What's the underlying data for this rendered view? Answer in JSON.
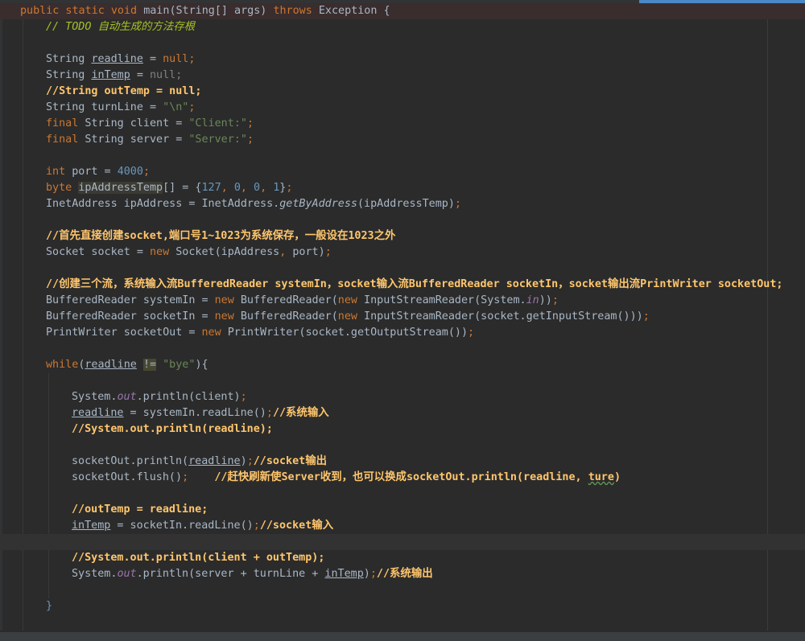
{
  "editor": {
    "language": "Java",
    "colors": {
      "background": "#2b2b2b",
      "keyword": "#cc7832",
      "number": "#6897bb",
      "string": "#6a8759",
      "comment": "#ffc66d",
      "todo": "#a8c023",
      "static_field": "#9876aa",
      "default_text": "#a9b7c6"
    },
    "lines": [
      {
        "id": "method-signature",
        "segments": [
          {
            "t": "public static void ",
            "c": "kw"
          },
          {
            "t": "main",
            "c": "pl"
          },
          {
            "t": "(String[] args) ",
            "c": "pl"
          },
          {
            "t": "throws ",
            "c": "kw"
          },
          {
            "t": "Exception {",
            "c": "pl"
          }
        ]
      },
      {
        "id": "todo-comment",
        "segments": [
          {
            "t": "// TODO 自动生成的方法存根",
            "c": "todo"
          }
        ]
      },
      {
        "id": "blank-1",
        "segments": []
      },
      {
        "id": "decl-readline",
        "segments": [
          {
            "t": "String ",
            "c": "pl"
          },
          {
            "t": "readline",
            "c": "pl u"
          },
          {
            "t": " = ",
            "c": "pl"
          },
          {
            "t": "null;",
            "c": "kw"
          }
        ]
      },
      {
        "id": "decl-intemp",
        "segments": [
          {
            "t": "String ",
            "c": "pl"
          },
          {
            "t": "inTemp",
            "c": "pl u"
          },
          {
            "t": " = ",
            "c": "pl"
          },
          {
            "t": "null;",
            "c": "nullgray"
          }
        ]
      },
      {
        "id": "comment-outtemp",
        "segments": [
          {
            "t": "//String outTemp = null;",
            "c": "cm"
          }
        ]
      },
      {
        "id": "decl-turnline",
        "segments": [
          {
            "t": "String turnLine = ",
            "c": "pl"
          },
          {
            "t": "\"\\n\"",
            "c": "str"
          },
          {
            "t": ";",
            "c": "punc"
          }
        ]
      },
      {
        "id": "decl-client",
        "segments": [
          {
            "t": "final ",
            "c": "kw"
          },
          {
            "t": "String client = ",
            "c": "pl"
          },
          {
            "t": "\"Client:\"",
            "c": "str"
          },
          {
            "t": ";",
            "c": "punc"
          }
        ]
      },
      {
        "id": "decl-server",
        "segments": [
          {
            "t": "final ",
            "c": "kw"
          },
          {
            "t": "String server = ",
            "c": "pl"
          },
          {
            "t": "\"Server:\"",
            "c": "str"
          },
          {
            "t": ";",
            "c": "punc"
          }
        ]
      },
      {
        "id": "blank-2",
        "segments": []
      },
      {
        "id": "decl-port",
        "segments": [
          {
            "t": "int ",
            "c": "kw"
          },
          {
            "t": "port = ",
            "c": "pl"
          },
          {
            "t": "4000",
            "c": "num"
          },
          {
            "t": ";",
            "c": "punc"
          }
        ]
      },
      {
        "id": "decl-ipaddresstemp",
        "segments": [
          {
            "t": "byte ",
            "c": "kw"
          },
          {
            "t": "ipAddressTemp",
            "c": "pl hl"
          },
          {
            "t": "[] = {",
            "c": "pl"
          },
          {
            "t": "127",
            "c": "num"
          },
          {
            "t": ", ",
            "c": "punc"
          },
          {
            "t": "0",
            "c": "num"
          },
          {
            "t": ", ",
            "c": "punc"
          },
          {
            "t": "0",
            "c": "num"
          },
          {
            "t": ", ",
            "c": "punc"
          },
          {
            "t": "1",
            "c": "num"
          },
          {
            "t": "}",
            "c": "pl"
          },
          {
            "t": ";",
            "c": "punc"
          }
        ]
      },
      {
        "id": "decl-ipaddress",
        "segments": [
          {
            "t": "InetAddress ipAddress = InetAddress.",
            "c": "pl"
          },
          {
            "t": "getByAddress",
            "c": "pl sm"
          },
          {
            "t": "(ipAddressTemp)",
            "c": "pl"
          },
          {
            "t": ";",
            "c": "punc"
          }
        ]
      },
      {
        "id": "blank-3",
        "segments": []
      },
      {
        "id": "comment-socket",
        "segments": [
          {
            "t": "//首先直接创建socket,端口号1~1023为系统保存，一般设在1023之外",
            "c": "cm"
          }
        ]
      },
      {
        "id": "decl-socket",
        "segments": [
          {
            "t": "Socket socket = ",
            "c": "pl"
          },
          {
            "t": "new ",
            "c": "kw"
          },
          {
            "t": "Socket(ipAddress",
            "c": "pl"
          },
          {
            "t": ", ",
            "c": "punc"
          },
          {
            "t": "port)",
            "c": "pl"
          },
          {
            "t": ";",
            "c": "punc"
          }
        ]
      },
      {
        "id": "blank-4",
        "segments": []
      },
      {
        "id": "comment-streams",
        "segments": [
          {
            "t": "//创建三个流，系统输入流BufferedReader systemIn，socket输入流BufferedReader socketIn，socket输出流PrintWriter socketOut;",
            "c": "cm"
          }
        ]
      },
      {
        "id": "decl-systemin",
        "segments": [
          {
            "t": "BufferedReader systemIn = ",
            "c": "pl"
          },
          {
            "t": "new ",
            "c": "kw"
          },
          {
            "t": "BufferedReader(",
            "c": "pl"
          },
          {
            "t": "new ",
            "c": "kw"
          },
          {
            "t": "InputStreamReader(System.",
            "c": "pl"
          },
          {
            "t": "in",
            "c": "fld"
          },
          {
            "t": "))",
            "c": "pl"
          },
          {
            "t": ";",
            "c": "punc"
          }
        ]
      },
      {
        "id": "decl-socketin",
        "segments": [
          {
            "t": "BufferedReader socketIn = ",
            "c": "pl"
          },
          {
            "t": "new ",
            "c": "kw"
          },
          {
            "t": "BufferedReader(",
            "c": "pl"
          },
          {
            "t": "new ",
            "c": "kw"
          },
          {
            "t": "InputStreamReader(socket.getInputStream()))",
            "c": "pl"
          },
          {
            "t": ";",
            "c": "punc"
          }
        ]
      },
      {
        "id": "decl-socketout",
        "segments": [
          {
            "t": "PrintWriter socketOut = ",
            "c": "pl"
          },
          {
            "t": "new ",
            "c": "kw"
          },
          {
            "t": "PrintWriter(socket.getOutputStream())",
            "c": "pl"
          },
          {
            "t": ";",
            "c": "punc"
          }
        ]
      },
      {
        "id": "blank-5",
        "segments": []
      },
      {
        "id": "while-header",
        "segments": [
          {
            "t": "while",
            "c": "kw"
          },
          {
            "t": "(",
            "c": "pl"
          },
          {
            "t": "readline",
            "c": "pl u"
          },
          {
            "t": " ",
            "c": "pl"
          },
          {
            "t": "!=",
            "c": "pl warn"
          },
          {
            "t": " ",
            "c": "pl"
          },
          {
            "t": "\"bye\"",
            "c": "str"
          },
          {
            "t": "){",
            "c": "pl"
          }
        ]
      },
      {
        "id": "blank-6",
        "segments": []
      },
      {
        "id": "println-client",
        "segments": [
          {
            "t": "System.",
            "c": "pl"
          },
          {
            "t": "out",
            "c": "fld"
          },
          {
            "t": ".println(client)",
            "c": "pl"
          },
          {
            "t": ";",
            "c": "punc"
          }
        ]
      },
      {
        "id": "assign-readline",
        "segments": [
          {
            "t": "readline",
            "c": "pl u"
          },
          {
            "t": " = systemIn.readLine()",
            "c": "pl"
          },
          {
            "t": ";",
            "c": "punc"
          },
          {
            "t": "//系统输入",
            "c": "cm"
          }
        ]
      },
      {
        "id": "comment-println-readline",
        "segments": [
          {
            "t": "//System.out.println(readline);",
            "c": "cm"
          }
        ]
      },
      {
        "id": "blank-7",
        "segments": []
      },
      {
        "id": "socketout-println",
        "segments": [
          {
            "t": "socketOut.println(",
            "c": "pl"
          },
          {
            "t": "readline",
            "c": "pl u"
          },
          {
            "t": ")",
            "c": "pl"
          },
          {
            "t": ";",
            "c": "punc"
          },
          {
            "t": "//socket输出",
            "c": "cm"
          }
        ]
      },
      {
        "id": "socketout-flush",
        "segments": [
          {
            "t": "socketOut.flush()",
            "c": "pl"
          },
          {
            "t": ";",
            "c": "punc"
          },
          {
            "t": "    //赶快刷新使Server收到，也可以换成socketOut.println(readline, ",
            "c": "cm"
          },
          {
            "t": "ture",
            "c": "cm typo"
          },
          {
            "t": ")",
            "c": "cm"
          }
        ]
      },
      {
        "id": "blank-8",
        "segments": []
      },
      {
        "id": "comment-outtemp-assign",
        "segments": [
          {
            "t": "//outTemp = readline;",
            "c": "cm"
          }
        ]
      },
      {
        "id": "assign-intemp",
        "segments": [
          {
            "t": "inTemp",
            "c": "pl u"
          },
          {
            "t": " = socketIn.readLine()",
            "c": "pl"
          },
          {
            "t": ";",
            "c": "punc"
          },
          {
            "t": "//socket输入",
            "c": "cm"
          }
        ]
      },
      {
        "id": "caret-line",
        "segments": []
      },
      {
        "id": "comment-println-client",
        "segments": [
          {
            "t": "//System.out.println(client + outTemp);",
            "c": "cm"
          }
        ]
      },
      {
        "id": "println-server",
        "segments": [
          {
            "t": "System.",
            "c": "pl"
          },
          {
            "t": "out",
            "c": "fld"
          },
          {
            "t": ".println(server + turnLine + ",
            "c": "pl"
          },
          {
            "t": "inTemp",
            "c": "pl u"
          },
          {
            "t": ")",
            "c": "pl"
          },
          {
            "t": ";",
            "c": "punc"
          },
          {
            "t": "//系统输出",
            "c": "cm"
          }
        ]
      },
      {
        "id": "blank-9",
        "segments": []
      },
      {
        "id": "while-close",
        "segments": [
          {
            "t": "}",
            "c": "num"
          }
        ]
      }
    ]
  }
}
